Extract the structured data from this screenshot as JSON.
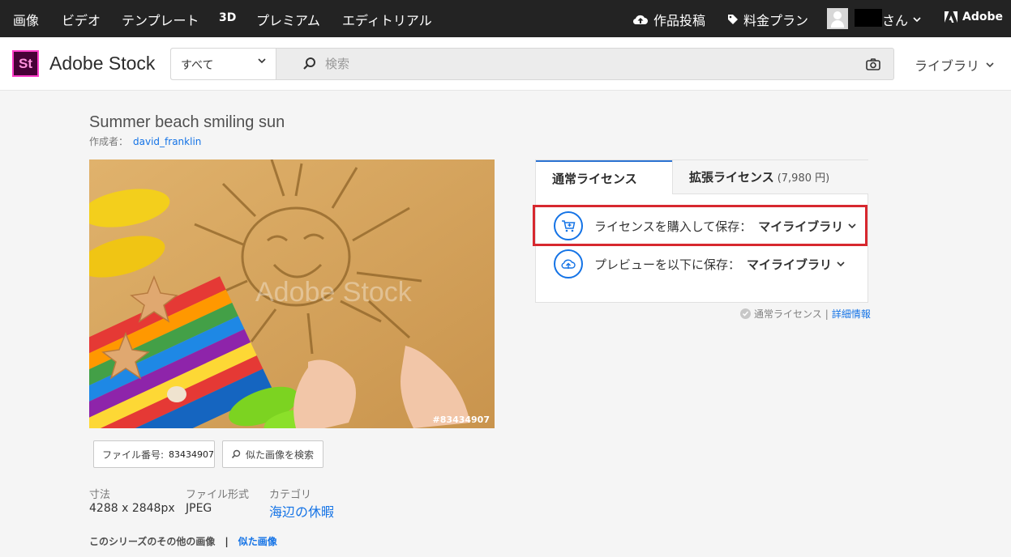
{
  "topnav": {
    "items": [
      "画像",
      "ビデオ",
      "テンプレート",
      "3D",
      "プレミアム",
      "エディトリアル"
    ],
    "contribute_label": "作品投稿",
    "pricing_label": "料金プラン",
    "user_suffix": "さん",
    "adobe_label": "Adobe"
  },
  "header": {
    "brand_mark": "St",
    "brand_name": "Adobe Stock",
    "search_scope": "すべて",
    "search_placeholder": "検索",
    "library_label": "ライブラリ"
  },
  "asset": {
    "title": "Summer beach smiling sun",
    "creator_label": "作成者：",
    "creator_name": "david_franklin",
    "image_id_overlay": "#83434907",
    "watermark": "Adobe Stock",
    "file_button_label": "ファイル番号:",
    "file_number": "83434907",
    "similar_button_label": "似た画像を検索",
    "meta": [
      {
        "label": "寸法",
        "value": "4288 x 2848px"
      },
      {
        "label": "ファイル形式",
        "value": "JPEG"
      },
      {
        "label": "カテゴリ",
        "value": "海辺の休暇"
      }
    ],
    "series_label": "このシリーズのその他の画像",
    "series_separator": "|",
    "similar_link": "似た画像"
  },
  "license": {
    "tab_standard": "通常ライセンス",
    "tab_extended": "拡張ライセンス",
    "tab_extended_price": "(7,980 円)",
    "buy_label": "ライセンスを購入して保存：",
    "buy_target": "マイライブラリ",
    "preview_label": "プレビューを以下に保存：",
    "preview_target": "マイライブラリ",
    "info_label": "通常ライセンス",
    "info_separator": "|",
    "info_link": "詳細情報"
  },
  "colors": {
    "topnav_bg": "#232323",
    "accent_blue": "#1473e6",
    "highlight_red": "#d7282f",
    "stock_logo_bg": "#470137"
  }
}
